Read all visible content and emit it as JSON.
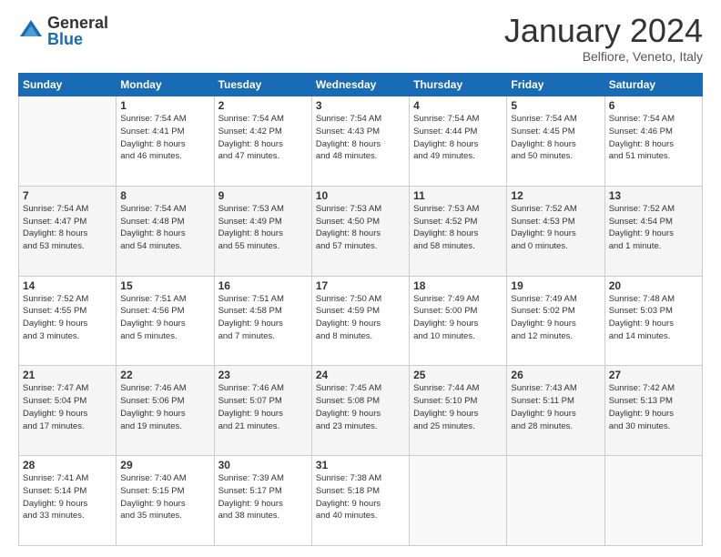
{
  "logo": {
    "general": "General",
    "blue": "Blue"
  },
  "title": "January 2024",
  "subtitle": "Belfiore, Veneto, Italy",
  "weekdays": [
    "Sunday",
    "Monday",
    "Tuesday",
    "Wednesday",
    "Thursday",
    "Friday",
    "Saturday"
  ],
  "weeks": [
    [
      {
        "day": "",
        "info": ""
      },
      {
        "day": "1",
        "info": "Sunrise: 7:54 AM\nSunset: 4:41 PM\nDaylight: 8 hours\nand 46 minutes."
      },
      {
        "day": "2",
        "info": "Sunrise: 7:54 AM\nSunset: 4:42 PM\nDaylight: 8 hours\nand 47 minutes."
      },
      {
        "day": "3",
        "info": "Sunrise: 7:54 AM\nSunset: 4:43 PM\nDaylight: 8 hours\nand 48 minutes."
      },
      {
        "day": "4",
        "info": "Sunrise: 7:54 AM\nSunset: 4:44 PM\nDaylight: 8 hours\nand 49 minutes."
      },
      {
        "day": "5",
        "info": "Sunrise: 7:54 AM\nSunset: 4:45 PM\nDaylight: 8 hours\nand 50 minutes."
      },
      {
        "day": "6",
        "info": "Sunrise: 7:54 AM\nSunset: 4:46 PM\nDaylight: 8 hours\nand 51 minutes."
      }
    ],
    [
      {
        "day": "7",
        "info": "Sunrise: 7:54 AM\nSunset: 4:47 PM\nDaylight: 8 hours\nand 53 minutes."
      },
      {
        "day": "8",
        "info": "Sunrise: 7:54 AM\nSunset: 4:48 PM\nDaylight: 8 hours\nand 54 minutes."
      },
      {
        "day": "9",
        "info": "Sunrise: 7:53 AM\nSunset: 4:49 PM\nDaylight: 8 hours\nand 55 minutes."
      },
      {
        "day": "10",
        "info": "Sunrise: 7:53 AM\nSunset: 4:50 PM\nDaylight: 8 hours\nand 57 minutes."
      },
      {
        "day": "11",
        "info": "Sunrise: 7:53 AM\nSunset: 4:52 PM\nDaylight: 8 hours\nand 58 minutes."
      },
      {
        "day": "12",
        "info": "Sunrise: 7:52 AM\nSunset: 4:53 PM\nDaylight: 9 hours\nand 0 minutes."
      },
      {
        "day": "13",
        "info": "Sunrise: 7:52 AM\nSunset: 4:54 PM\nDaylight: 9 hours\nand 1 minute."
      }
    ],
    [
      {
        "day": "14",
        "info": "Sunrise: 7:52 AM\nSunset: 4:55 PM\nDaylight: 9 hours\nand 3 minutes."
      },
      {
        "day": "15",
        "info": "Sunrise: 7:51 AM\nSunset: 4:56 PM\nDaylight: 9 hours\nand 5 minutes."
      },
      {
        "day": "16",
        "info": "Sunrise: 7:51 AM\nSunset: 4:58 PM\nDaylight: 9 hours\nand 7 minutes."
      },
      {
        "day": "17",
        "info": "Sunrise: 7:50 AM\nSunset: 4:59 PM\nDaylight: 9 hours\nand 8 minutes."
      },
      {
        "day": "18",
        "info": "Sunrise: 7:49 AM\nSunset: 5:00 PM\nDaylight: 9 hours\nand 10 minutes."
      },
      {
        "day": "19",
        "info": "Sunrise: 7:49 AM\nSunset: 5:02 PM\nDaylight: 9 hours\nand 12 minutes."
      },
      {
        "day": "20",
        "info": "Sunrise: 7:48 AM\nSunset: 5:03 PM\nDaylight: 9 hours\nand 14 minutes."
      }
    ],
    [
      {
        "day": "21",
        "info": "Sunrise: 7:47 AM\nSunset: 5:04 PM\nDaylight: 9 hours\nand 17 minutes."
      },
      {
        "day": "22",
        "info": "Sunrise: 7:46 AM\nSunset: 5:06 PM\nDaylight: 9 hours\nand 19 minutes."
      },
      {
        "day": "23",
        "info": "Sunrise: 7:46 AM\nSunset: 5:07 PM\nDaylight: 9 hours\nand 21 minutes."
      },
      {
        "day": "24",
        "info": "Sunrise: 7:45 AM\nSunset: 5:08 PM\nDaylight: 9 hours\nand 23 minutes."
      },
      {
        "day": "25",
        "info": "Sunrise: 7:44 AM\nSunset: 5:10 PM\nDaylight: 9 hours\nand 25 minutes."
      },
      {
        "day": "26",
        "info": "Sunrise: 7:43 AM\nSunset: 5:11 PM\nDaylight: 9 hours\nand 28 minutes."
      },
      {
        "day": "27",
        "info": "Sunrise: 7:42 AM\nSunset: 5:13 PM\nDaylight: 9 hours\nand 30 minutes."
      }
    ],
    [
      {
        "day": "28",
        "info": "Sunrise: 7:41 AM\nSunset: 5:14 PM\nDaylight: 9 hours\nand 33 minutes."
      },
      {
        "day": "29",
        "info": "Sunrise: 7:40 AM\nSunset: 5:15 PM\nDaylight: 9 hours\nand 35 minutes."
      },
      {
        "day": "30",
        "info": "Sunrise: 7:39 AM\nSunset: 5:17 PM\nDaylight: 9 hours\nand 38 minutes."
      },
      {
        "day": "31",
        "info": "Sunrise: 7:38 AM\nSunset: 5:18 PM\nDaylight: 9 hours\nand 40 minutes."
      },
      {
        "day": "",
        "info": ""
      },
      {
        "day": "",
        "info": ""
      },
      {
        "day": "",
        "info": ""
      }
    ]
  ]
}
